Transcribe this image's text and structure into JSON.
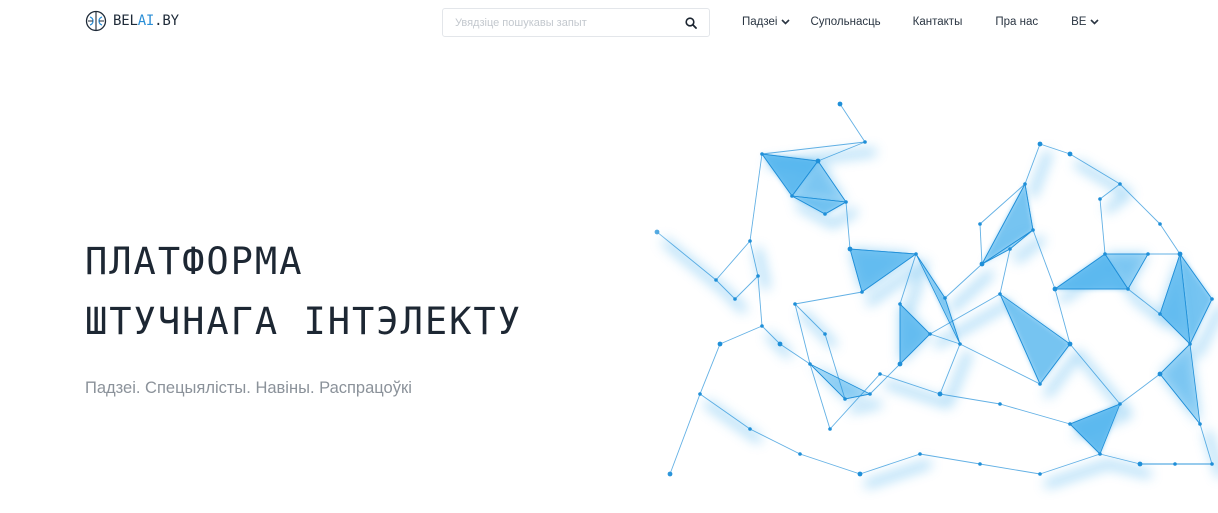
{
  "header": {
    "logo": {
      "prefix": "BEL",
      "accent": "AI",
      "suffix": ".BY",
      "icon": "brain-icon"
    },
    "search": {
      "placeholder": "Увядзіце пошукавы запыт",
      "value": "",
      "icon": "search-icon"
    },
    "nav": {
      "events": "Падзеі",
      "community": "Супольнасць",
      "contacts": "Кантакты",
      "about": "Пра нас",
      "language": "BE"
    }
  },
  "hero": {
    "title_line1": "ПЛАТФОРМА",
    "title_line2": "ШТУЧНАГА ІНТЭЛЕКТУ",
    "subtitle": "Падзеі. Спецыялісты. Навіны. Распрацоўкі"
  },
  "colors": {
    "accent": "#2a8ed6",
    "network_node": "#1f8fd8",
    "network_fill": "#4fb3ee",
    "text_dark": "#1d2733",
    "text_muted": "#8b929a"
  }
}
